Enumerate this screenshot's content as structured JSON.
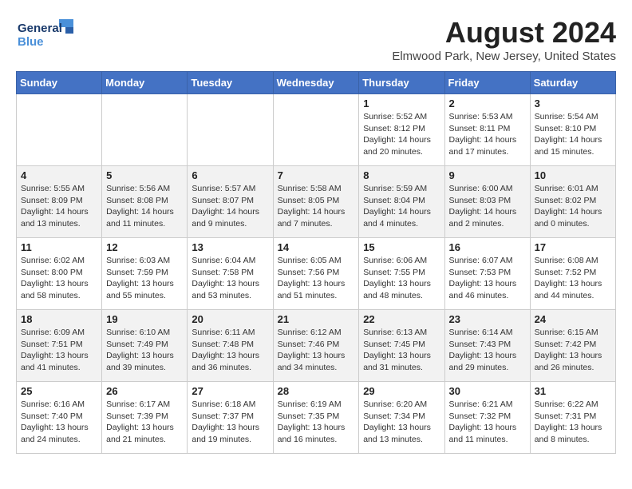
{
  "header": {
    "logo_line1": "General",
    "logo_line2": "Blue",
    "month_year": "August 2024",
    "location": "Elmwood Park, New Jersey, United States"
  },
  "days_of_week": [
    "Sunday",
    "Monday",
    "Tuesday",
    "Wednesday",
    "Thursday",
    "Friday",
    "Saturday"
  ],
  "weeks": [
    [
      {
        "day": "",
        "info": ""
      },
      {
        "day": "",
        "info": ""
      },
      {
        "day": "",
        "info": ""
      },
      {
        "day": "",
        "info": ""
      },
      {
        "day": "1",
        "info": "Sunrise: 5:52 AM\nSunset: 8:12 PM\nDaylight: 14 hours\nand 20 minutes."
      },
      {
        "day": "2",
        "info": "Sunrise: 5:53 AM\nSunset: 8:11 PM\nDaylight: 14 hours\nand 17 minutes."
      },
      {
        "day": "3",
        "info": "Sunrise: 5:54 AM\nSunset: 8:10 PM\nDaylight: 14 hours\nand 15 minutes."
      }
    ],
    [
      {
        "day": "4",
        "info": "Sunrise: 5:55 AM\nSunset: 8:09 PM\nDaylight: 14 hours\nand 13 minutes."
      },
      {
        "day": "5",
        "info": "Sunrise: 5:56 AM\nSunset: 8:08 PM\nDaylight: 14 hours\nand 11 minutes."
      },
      {
        "day": "6",
        "info": "Sunrise: 5:57 AM\nSunset: 8:07 PM\nDaylight: 14 hours\nand 9 minutes."
      },
      {
        "day": "7",
        "info": "Sunrise: 5:58 AM\nSunset: 8:05 PM\nDaylight: 14 hours\nand 7 minutes."
      },
      {
        "day": "8",
        "info": "Sunrise: 5:59 AM\nSunset: 8:04 PM\nDaylight: 14 hours\nand 4 minutes."
      },
      {
        "day": "9",
        "info": "Sunrise: 6:00 AM\nSunset: 8:03 PM\nDaylight: 14 hours\nand 2 minutes."
      },
      {
        "day": "10",
        "info": "Sunrise: 6:01 AM\nSunset: 8:02 PM\nDaylight: 14 hours\nand 0 minutes."
      }
    ],
    [
      {
        "day": "11",
        "info": "Sunrise: 6:02 AM\nSunset: 8:00 PM\nDaylight: 13 hours\nand 58 minutes."
      },
      {
        "day": "12",
        "info": "Sunrise: 6:03 AM\nSunset: 7:59 PM\nDaylight: 13 hours\nand 55 minutes."
      },
      {
        "day": "13",
        "info": "Sunrise: 6:04 AM\nSunset: 7:58 PM\nDaylight: 13 hours\nand 53 minutes."
      },
      {
        "day": "14",
        "info": "Sunrise: 6:05 AM\nSunset: 7:56 PM\nDaylight: 13 hours\nand 51 minutes."
      },
      {
        "day": "15",
        "info": "Sunrise: 6:06 AM\nSunset: 7:55 PM\nDaylight: 13 hours\nand 48 minutes."
      },
      {
        "day": "16",
        "info": "Sunrise: 6:07 AM\nSunset: 7:53 PM\nDaylight: 13 hours\nand 46 minutes."
      },
      {
        "day": "17",
        "info": "Sunrise: 6:08 AM\nSunset: 7:52 PM\nDaylight: 13 hours\nand 44 minutes."
      }
    ],
    [
      {
        "day": "18",
        "info": "Sunrise: 6:09 AM\nSunset: 7:51 PM\nDaylight: 13 hours\nand 41 minutes."
      },
      {
        "day": "19",
        "info": "Sunrise: 6:10 AM\nSunset: 7:49 PM\nDaylight: 13 hours\nand 39 minutes."
      },
      {
        "day": "20",
        "info": "Sunrise: 6:11 AM\nSunset: 7:48 PM\nDaylight: 13 hours\nand 36 minutes."
      },
      {
        "day": "21",
        "info": "Sunrise: 6:12 AM\nSunset: 7:46 PM\nDaylight: 13 hours\nand 34 minutes."
      },
      {
        "day": "22",
        "info": "Sunrise: 6:13 AM\nSunset: 7:45 PM\nDaylight: 13 hours\nand 31 minutes."
      },
      {
        "day": "23",
        "info": "Sunrise: 6:14 AM\nSunset: 7:43 PM\nDaylight: 13 hours\nand 29 minutes."
      },
      {
        "day": "24",
        "info": "Sunrise: 6:15 AM\nSunset: 7:42 PM\nDaylight: 13 hours\nand 26 minutes."
      }
    ],
    [
      {
        "day": "25",
        "info": "Sunrise: 6:16 AM\nSunset: 7:40 PM\nDaylight: 13 hours\nand 24 minutes."
      },
      {
        "day": "26",
        "info": "Sunrise: 6:17 AM\nSunset: 7:39 PM\nDaylight: 13 hours\nand 21 minutes."
      },
      {
        "day": "27",
        "info": "Sunrise: 6:18 AM\nSunset: 7:37 PM\nDaylight: 13 hours\nand 19 minutes."
      },
      {
        "day": "28",
        "info": "Sunrise: 6:19 AM\nSunset: 7:35 PM\nDaylight: 13 hours\nand 16 minutes."
      },
      {
        "day": "29",
        "info": "Sunrise: 6:20 AM\nSunset: 7:34 PM\nDaylight: 13 hours\nand 13 minutes."
      },
      {
        "day": "30",
        "info": "Sunrise: 6:21 AM\nSunset: 7:32 PM\nDaylight: 13 hours\nand 11 minutes."
      },
      {
        "day": "31",
        "info": "Sunrise: 6:22 AM\nSunset: 7:31 PM\nDaylight: 13 hours\nand 8 minutes."
      }
    ]
  ]
}
